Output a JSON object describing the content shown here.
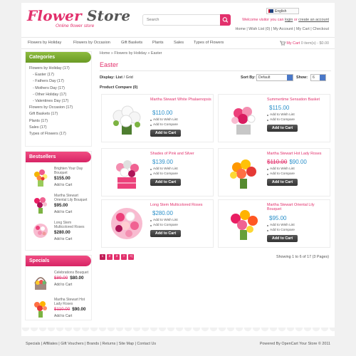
{
  "header": {
    "logo_title_a": "Flower",
    "logo_title_b": "Store",
    "logo_tagline": "Online flower store",
    "search_placeholder": "Search",
    "language": "English",
    "welcome_prefix": "Welcome visitor you can",
    "login_label": "login",
    "welcome_or": "or",
    "create_account_label": "create an account",
    "toplinks": [
      "Home",
      "Wish List (0)",
      "My Account",
      "My Cart",
      "Checkout"
    ],
    "cart_label": "My Cart",
    "cart_info": "0 item(s) - $0.00"
  },
  "nav": [
    "Flowers by Holiday",
    "Flowers by Occasion",
    "Gift Baskets",
    "Plants",
    "Sales",
    "Types of Flowers"
  ],
  "sidebar": {
    "categories_title": "Categories",
    "categories": [
      {
        "label": "Flowers by Holiday (17)",
        "sub": false
      },
      {
        "label": "- Easter (17)",
        "sub": true
      },
      {
        "label": "- Fathers Day (17)",
        "sub": true
      },
      {
        "label": "- Mothers Day (17)",
        "sub": true
      },
      {
        "label": "- Other Holiday (17)",
        "sub": true
      },
      {
        "label": "- Valentines Day (17)",
        "sub": true
      },
      {
        "label": "Flowers by Occasion (17)",
        "sub": false
      },
      {
        "label": "Gift Baskets (17)",
        "sub": false
      },
      {
        "label": "Plants (17)",
        "sub": false
      },
      {
        "label": "Sales (17)",
        "sub": false
      },
      {
        "label": "Types of Flowers (17)",
        "sub": false
      }
    ],
    "bestsellers_title": "Bestsellers",
    "bestsellers": [
      {
        "name": "Brighten Your Day Bouquet",
        "price": "$155.00",
        "cart": "Add to Cart"
      },
      {
        "name": "Martha Stewart Oriental Lily Bouquet",
        "price": "$95.00",
        "cart": "Add to Cart"
      },
      {
        "name": "Long Stem Multicolored Roses",
        "price": "$280.00",
        "cart": "Add to Cart"
      }
    ],
    "specials_title": "Specials",
    "specials": [
      {
        "name": "Celebrations Bouquet",
        "old": "$89.00",
        "price": "$80.00",
        "cart": "Add to Cart"
      },
      {
        "name": "Martha Stewart Hot Lady Roses",
        "old": "$110.00",
        "price": "$90.00",
        "cart": "Add to Cart"
      }
    ]
  },
  "main": {
    "breadcrumb": "Home » Flowers by Holiday » Easter",
    "title": "Easter",
    "display_label": "Display:",
    "display_list": "List",
    "display_sep": "/",
    "display_grid": "Grid",
    "sort_label": "Sort By:",
    "sort_value": "Default",
    "show_label": "Show:",
    "show_value": "6",
    "compare": "Product Compare (0)",
    "wishlist_label": "Add to Wish List",
    "compare_label": "Add to Compare",
    "cart_button": "Add to Cart",
    "products": [
      {
        "name": "Martha Stewart White Phalaenopsis",
        "price": "$110.00",
        "old": ""
      },
      {
        "name": "Summertime Sensation Basket",
        "price": "$115.00",
        "old": ""
      },
      {
        "name": "Shades of Pink and Silver",
        "price": "$139.00",
        "old": ""
      },
      {
        "name": "Martha Stewart Hot Lady Roses",
        "price": "$90.00",
        "old": "$110.00"
      },
      {
        "name": "Long Stem Multicolored Roses",
        "price": "$280.00",
        "old": ""
      },
      {
        "name": "Martha Stewart Oriental Lily Bouquet",
        "price": "$95.00",
        "old": ""
      }
    ],
    "pages": [
      "1",
      "2",
      "3",
      ">",
      ">|"
    ],
    "showing": "Showing 1 to 6 of 17 (3 Pages)"
  },
  "footer": {
    "links": [
      "Specials",
      "Affiliates",
      "Gift Vouchers",
      "Brands",
      "Returns",
      "Site Map",
      "Contact Us"
    ],
    "powered": "Powered By OpenCart Your Store © 2011"
  },
  "colors": {
    "accent": "#e2306c",
    "price_blue": "#2a8fc9",
    "sidebar_green": "#7aa92f",
    "page_bg": "#f1f1f1"
  }
}
